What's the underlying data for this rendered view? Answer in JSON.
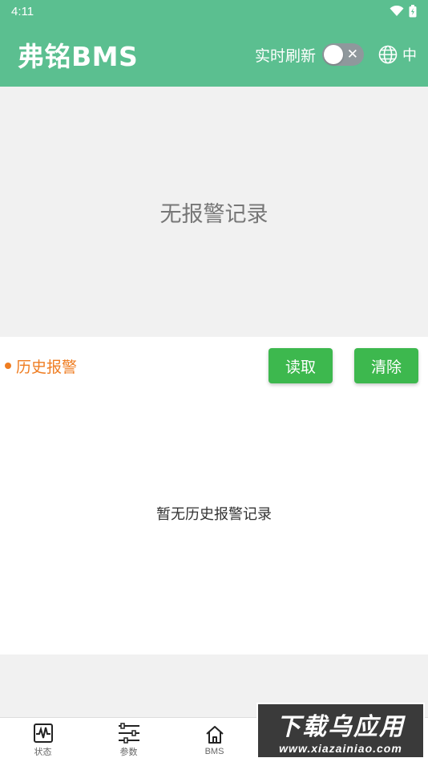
{
  "status_bar": {
    "time": "4:11",
    "icons": [
      "wifi-icon",
      "battery-icon"
    ]
  },
  "app_bar": {
    "title": "弗铭BMS",
    "refresh_label": "实时刷新",
    "toggle_on": false,
    "language_label": "中"
  },
  "current_alarms": {
    "empty_text": "无报警记录"
  },
  "history": {
    "title": "历史报警",
    "read_label": "读取",
    "clear_label": "清除",
    "empty_text": "暂无历史报警记录"
  },
  "bottom_nav": {
    "items": [
      {
        "label": "状态",
        "icon": "waveform-icon"
      },
      {
        "label": "参数",
        "icon": "list-settings-icon"
      },
      {
        "label": "BMS",
        "icon": "home-icon"
      }
    ]
  },
  "watermark": {
    "title": "下载乌应用",
    "url": "www.xiazainiao.com"
  },
  "colors": {
    "header_green": "#5bbf90",
    "button_green": "#3db84e",
    "accent_orange": "#ef7d22",
    "toggle_off": "#8f989c"
  }
}
